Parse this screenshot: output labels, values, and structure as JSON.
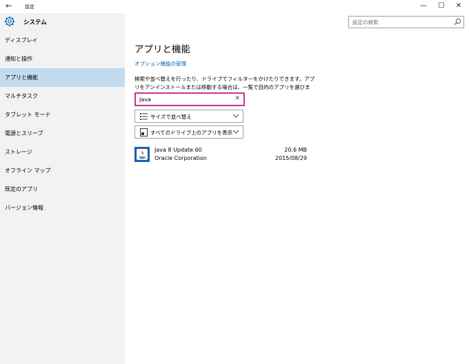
{
  "window": {
    "title": "設定",
    "back_icon": "back-arrow-icon",
    "minimize_glyph": "—",
    "maximize_glyph": "☐",
    "close_glyph": "✕"
  },
  "sidebar": {
    "header_title": "システム",
    "items": [
      {
        "label": "ディスプレイ",
        "selected": false
      },
      {
        "label": "通知と操作",
        "selected": false
      },
      {
        "label": "アプリと機能",
        "selected": true
      },
      {
        "label": "マルチタスク",
        "selected": false
      },
      {
        "label": "タブレット モード",
        "selected": false
      },
      {
        "label": "電源とスリープ",
        "selected": false
      },
      {
        "label": "ストレージ",
        "selected": false
      },
      {
        "label": "オフライン マップ",
        "selected": false
      },
      {
        "label": "既定のアプリ",
        "selected": false
      },
      {
        "label": "バージョン情報",
        "selected": false
      }
    ]
  },
  "search": {
    "placeholder": "設定の検索"
  },
  "main": {
    "title": "アプリと機能",
    "optional_link": "オプション機能の管理",
    "description": "検索や並べ替えを行ったり、ドライブでフィルターをかけたりできます。アプリをアンインストールまたは移動する場合は、一覧で目的のアプリを選びます。",
    "filter_value": "Java",
    "clear_glyph": "✕",
    "sort_label": "サイズで並べ替え",
    "drive_label": "すべてのドライブ上のアプリを表示",
    "apps": [
      {
        "name": "Java 8 Update 60",
        "publisher": "Oracle Corporation",
        "size": "20.6 MB",
        "date": "2015/08/29"
      }
    ]
  },
  "colors": {
    "accent": "#0063b1",
    "selected_bg": "#c2dbef",
    "sidebar_bg": "#f2f2f2",
    "focus_border": "#c8338c"
  }
}
